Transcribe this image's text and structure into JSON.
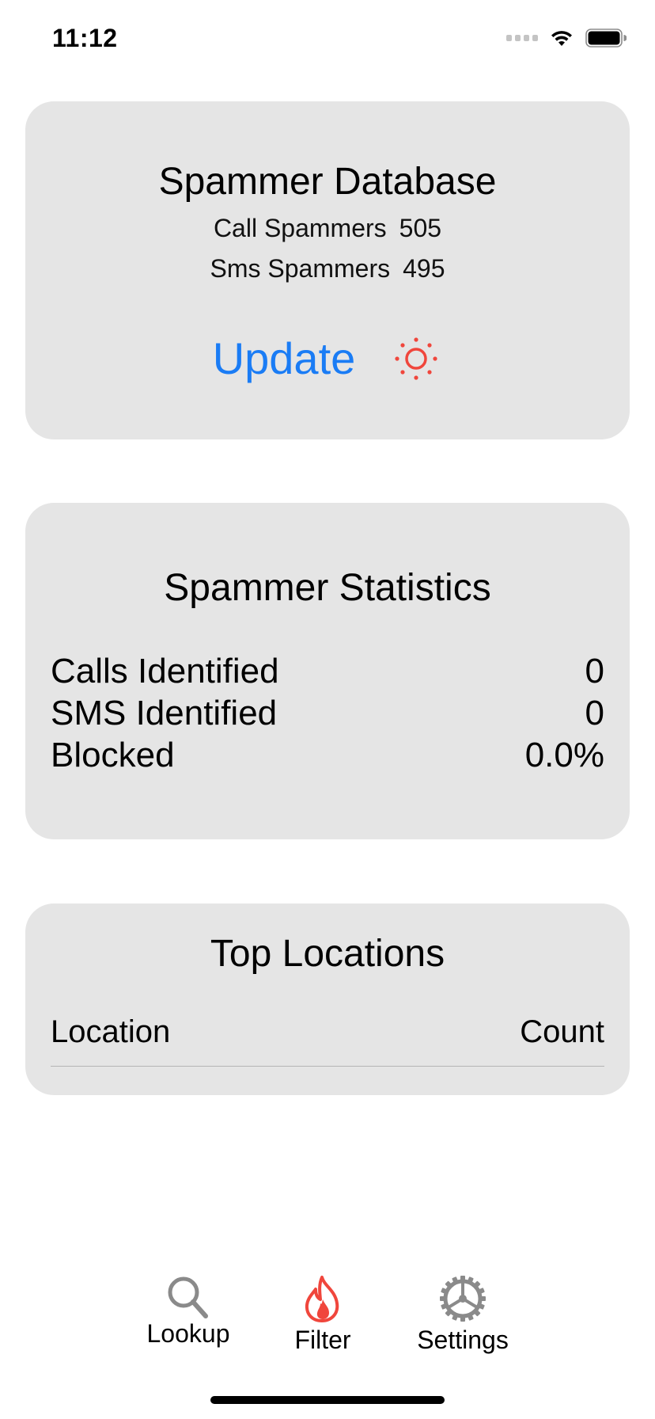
{
  "status_bar": {
    "time": "11:12"
  },
  "database_card": {
    "title": "Spammer Database",
    "call_label": "Call Spammers",
    "call_count": "505",
    "sms_label": "Sms Spammers",
    "sms_count": "495",
    "update_label": "Update",
    "update_icon": "sun-icon"
  },
  "statistics_card": {
    "title": "Spammer Statistics",
    "rows": [
      {
        "label": "Calls Identified",
        "value": "0"
      },
      {
        "label": "SMS Identified",
        "value": "0"
      },
      {
        "label": "Blocked",
        "value": "0.0%"
      }
    ]
  },
  "locations_card": {
    "title": "Top Locations",
    "columns": [
      "Location",
      "Count"
    ]
  },
  "tab_bar": {
    "items": [
      {
        "label": "Lookup",
        "icon": "magnifier-icon",
        "active": false
      },
      {
        "label": "Filter",
        "icon": "flame-icon",
        "active": true
      },
      {
        "label": "Settings",
        "icon": "gear-icon",
        "active": false
      }
    ]
  },
  "colors": {
    "accent_blue": "#1a7cf5",
    "accent_red": "#f0463c",
    "card_background": "#e5e5e5",
    "inactive_icon": "#8a8a8a"
  }
}
